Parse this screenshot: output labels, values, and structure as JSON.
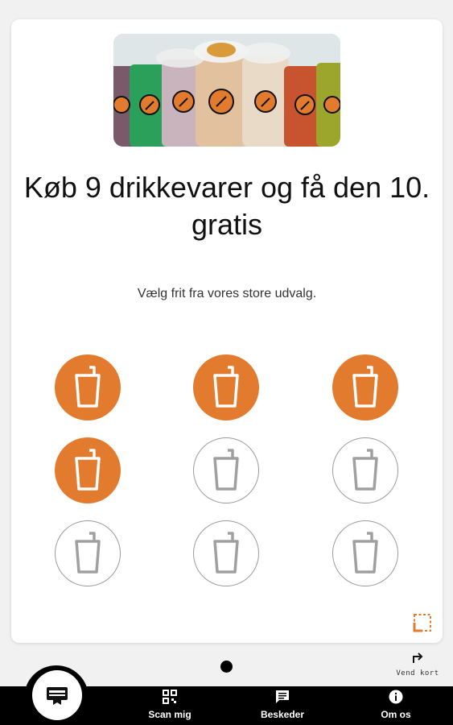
{
  "card": {
    "title": "Køb 9 drikkevarer og få den 10. gratis",
    "subtitle": "Vælg frit fra vores store udvalg."
  },
  "stamps": {
    "collected": 4,
    "total": 9
  },
  "colors": {
    "accent": "#e27b2d",
    "nav_background": "#000000"
  },
  "pager": {
    "pages": 1,
    "active": 1
  },
  "flip": {
    "label": "Vend kort",
    "icon": "turn-arrow-icon"
  },
  "nav": {
    "home_icon": "loyalty-card-icon",
    "items": [
      {
        "label": "Scan mig",
        "icon": "qr-code-icon"
      },
      {
        "label": "Beskeder",
        "icon": "message-icon"
      },
      {
        "label": "Om os",
        "icon": "info-icon"
      }
    ]
  }
}
